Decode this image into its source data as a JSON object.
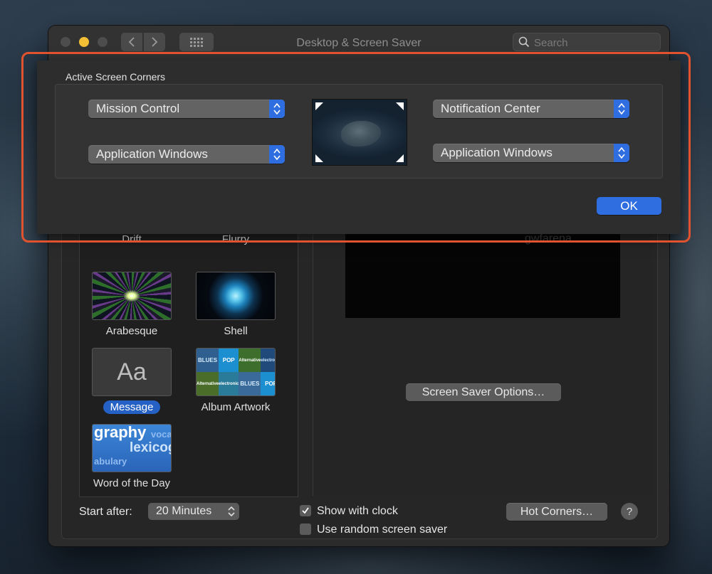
{
  "window": {
    "title": "Desktop & Screen Saver"
  },
  "search": {
    "placeholder": "Search"
  },
  "sheet": {
    "title": "Active Screen Corners",
    "top_left": "Mission Control",
    "top_right": "Notification Center",
    "bottom_left": "Application Windows",
    "bottom_right": "Application Windows",
    "ok_label": "OK"
  },
  "screen_savers": [
    {
      "label": "Drift"
    },
    {
      "label": "Flurry"
    },
    {
      "label": "Arabesque"
    },
    {
      "label": "Shell"
    },
    {
      "label": "Message",
      "selected": true,
      "thumb_text": "Aa"
    },
    {
      "label": "Album Artwork"
    },
    {
      "label": "Word of the Day",
      "thumb_words": [
        "graphy",
        "voca",
        "lexicog",
        "abulary"
      ]
    }
  ],
  "album_tile_words": [
    "BLUES",
    "POP",
    "Alternative",
    "electronic",
    "Alternative",
    "electronic",
    "BLUES",
    "POP"
  ],
  "preview": {
    "text": "gwfarena",
    "options_button": "Screen Saver Options…"
  },
  "footer": {
    "start_after_label": "Start after:",
    "start_after_value": "20 Minutes",
    "show_with_clock": "Show with clock",
    "use_random": "Use random screen saver",
    "hot_corners_button": "Hot Corners…",
    "help": "?"
  },
  "colors": {
    "accent": "#2f6ee0",
    "highlight": "#e1522f"
  }
}
